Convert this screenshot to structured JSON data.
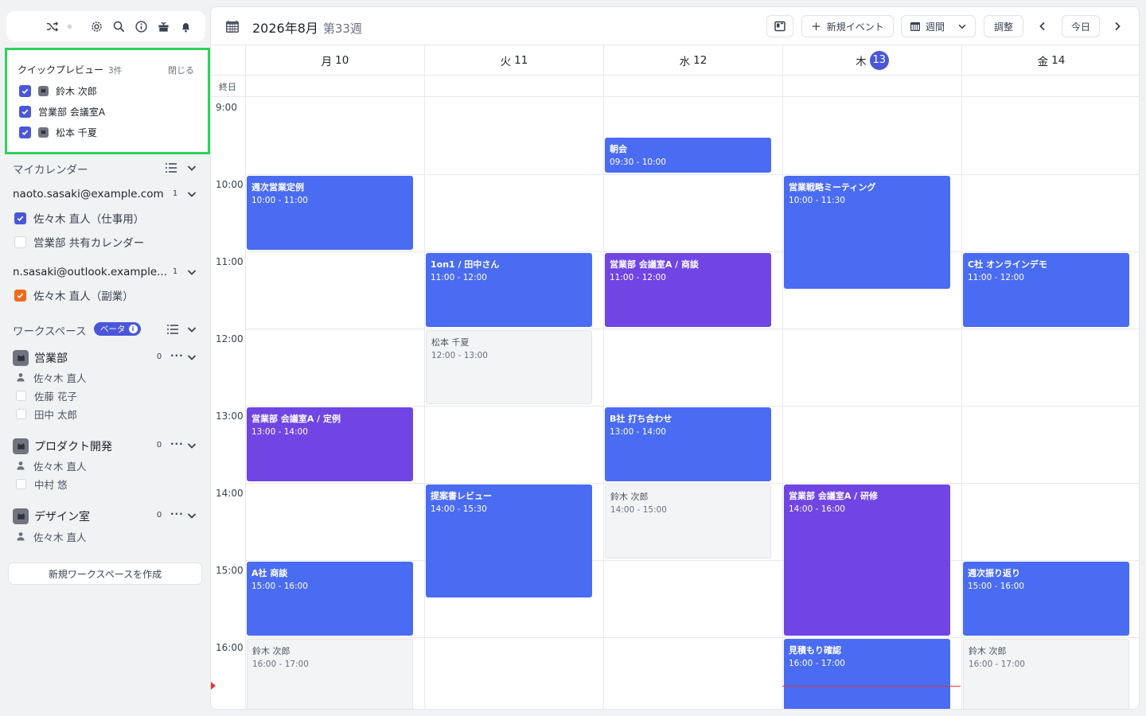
{
  "quick_preview": {
    "title": "クイックプレビュー",
    "count": "3件",
    "close": "閉じる",
    "items": [
      {
        "label": "鈴木 次郎",
        "type": "person"
      },
      {
        "label": "営業部 会議室A",
        "type": "room"
      },
      {
        "label": "松本 千夏",
        "type": "person"
      }
    ]
  },
  "sidebar": {
    "my_calendars": "マイカレンダー",
    "accounts": [
      {
        "email": "naoto.sasaki@example.com",
        "count": "1",
        "calendars": [
          {
            "label": "佐々木 直人（仕事用）",
            "checked": true,
            "color": "#4a57d9"
          },
          {
            "label": "営業部 共有カレンダー",
            "checked": false
          }
        ]
      },
      {
        "email": "n.sasaki@outlook.example...",
        "count": "1",
        "calendars": [
          {
            "label": "佐々木 直人（副業）",
            "checked": true,
            "color": "#ef6a1f"
          }
        ]
      }
    ],
    "workspace_title": "ワークスペース",
    "beta": "ベータ",
    "workspaces": [
      {
        "name": "営業部",
        "count": "0",
        "members": [
          {
            "label": "佐々木 直人",
            "type": "self"
          },
          {
            "label": "佐藤 花子",
            "type": "check"
          },
          {
            "label": "田中 太郎",
            "type": "check"
          }
        ]
      },
      {
        "name": "プロダクト開発",
        "count": "0",
        "members": [
          {
            "label": "佐々木 直人",
            "type": "self"
          },
          {
            "label": "中村 悠",
            "type": "check"
          }
        ]
      },
      {
        "name": "デザイン室",
        "count": "0",
        "members": [
          {
            "label": "佐々木 直人",
            "type": "self"
          }
        ]
      }
    ],
    "new_workspace": "新規ワークスペースを作成"
  },
  "header": {
    "title": "2026年8月",
    "week": "第33週",
    "new_event": "新規イベント",
    "view": "週間",
    "adjust": "調整",
    "today": "今日"
  },
  "days": [
    {
      "dow": "月",
      "num": "10",
      "today": false
    },
    {
      "dow": "火",
      "num": "11",
      "today": false
    },
    {
      "dow": "水",
      "num": "12",
      "today": false
    },
    {
      "dow": "木",
      "num": "13",
      "today": true
    },
    {
      "dow": "金",
      "num": "14",
      "today": false
    }
  ],
  "allday_label": "終日",
  "hours": [
    "9:00",
    "10:00",
    "11:00",
    "12:00",
    "13:00",
    "14:00",
    "15:00",
    "16:00"
  ],
  "events": [
    {
      "day": 2,
      "title": "朝会",
      "time": "09:30 - 10:00",
      "start": 9.5,
      "end": 10,
      "style": "blue"
    },
    {
      "day": 0,
      "title": "週次営業定例",
      "time": "10:00 - 11:00",
      "start": 10,
      "end": 11,
      "style": "blue"
    },
    {
      "day": 3,
      "title": "営業戦略ミーティング",
      "time": "10:00 - 11:30",
      "start": 10,
      "end": 11.5,
      "style": "blue"
    },
    {
      "day": 1,
      "title": "1on1 / 田中さん",
      "time": "11:00 - 12:00",
      "start": 11,
      "end": 12,
      "style": "blue"
    },
    {
      "day": 2,
      "title": "営業部 会議室A / 商談",
      "time": "11:00 - 12:00",
      "start": 11,
      "end": 12,
      "style": "purple"
    },
    {
      "day": 4,
      "title": "C社 オンラインデモ",
      "time": "11:00 - 12:00",
      "start": 11,
      "end": 12,
      "style": "blue"
    },
    {
      "day": 1,
      "title": "松本 千夏",
      "time": "12:00 - 13:00",
      "start": 12,
      "end": 13,
      "style": "gray"
    },
    {
      "day": 0,
      "title": "営業部 会議室A / 定例",
      "time": "13:00 - 14:00",
      "start": 13,
      "end": 14,
      "style": "purple"
    },
    {
      "day": 2,
      "title": "B社 打ち合わせ",
      "time": "13:00 - 14:00",
      "start": 13,
      "end": 14,
      "style": "blue"
    },
    {
      "day": 1,
      "title": "提案書レビュー",
      "time": "14:00 - 15:30",
      "start": 14,
      "end": 15.5,
      "style": "blue"
    },
    {
      "day": 2,
      "title": "鈴木 次郎",
      "time": "14:00 - 15:00",
      "start": 14,
      "end": 15,
      "style": "gray"
    },
    {
      "day": 3,
      "title": "営業部 会議室A / 研修",
      "time": "14:00 - 16:00",
      "start": 14,
      "end": 16,
      "style": "purple"
    },
    {
      "day": 0,
      "title": "A社 商談",
      "time": "15:00 - 16:00",
      "start": 15,
      "end": 16,
      "style": "blue"
    },
    {
      "day": 4,
      "title": "週次振り返り",
      "time": "15:00 - 16:00",
      "start": 15,
      "end": 16,
      "style": "blue"
    },
    {
      "day": 0,
      "title": "鈴木 次郎",
      "time": "16:00 - 17:00",
      "start": 16,
      "end": 17,
      "style": "gray"
    },
    {
      "day": 3,
      "title": "見積もり確認",
      "time": "16:00 - 17:00",
      "start": 16,
      "end": 17,
      "style": "blue"
    },
    {
      "day": 4,
      "title": "鈴木 次郎",
      "time": "16:00 - 17:00",
      "start": 16,
      "end": 17,
      "style": "gray"
    }
  ]
}
